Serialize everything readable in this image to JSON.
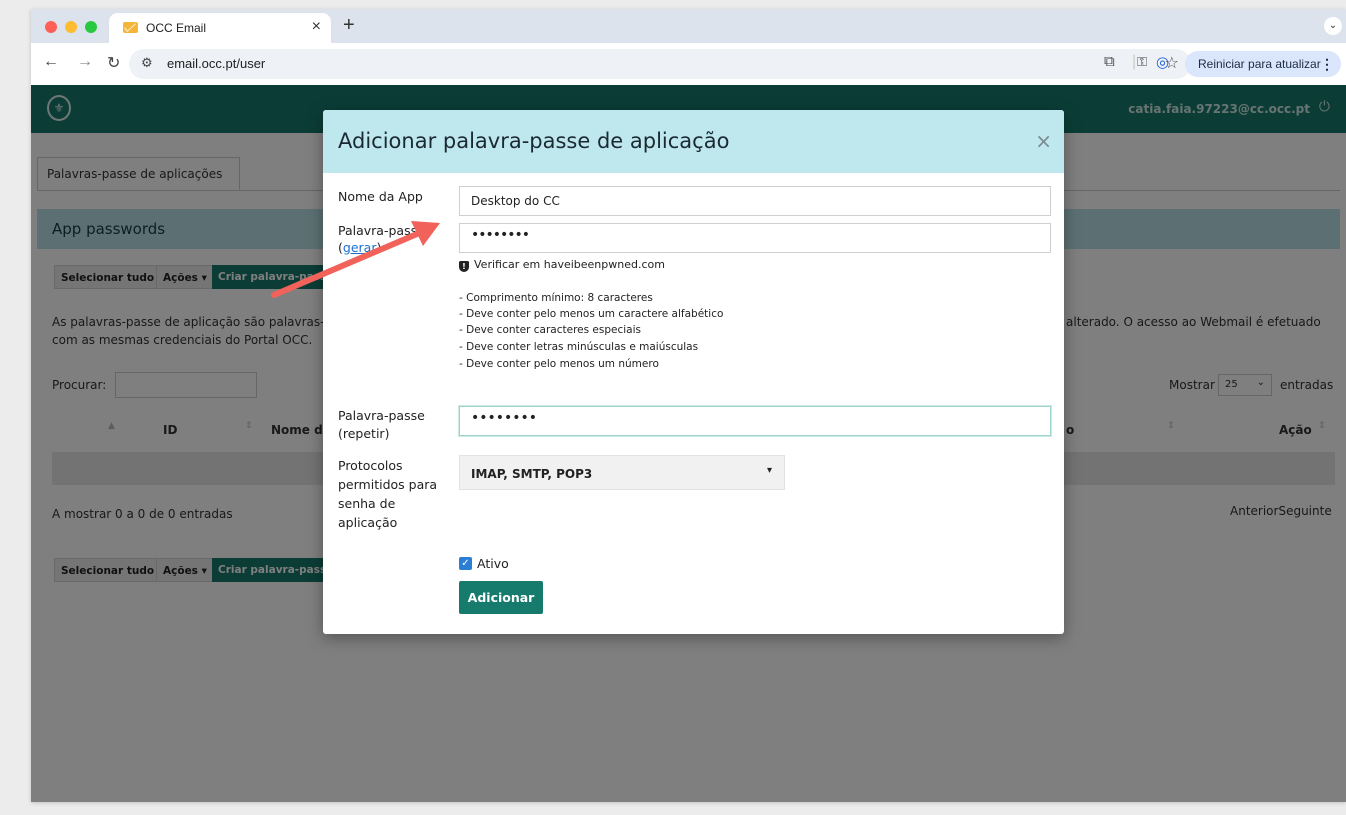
{
  "browser": {
    "tab_title": "OCC Email",
    "tab_close": "×",
    "new_tab": "+",
    "url": "email.occ.pt/user",
    "update_button": "Reiniciar para atualizar",
    "menu_dots": "⋮"
  },
  "app": {
    "user_email": "catia.faia.97223@cc.occ.pt",
    "tab_label": "Palavras-passe de aplicações",
    "panel_title": "App passwords",
    "toolbar": {
      "select_all": "Selecionar tudo",
      "actions": "Ações ▾",
      "create": "Criar palavra-passe"
    },
    "description_left_line1": "As palavras-passe de aplicação são palavras-",
    "description_left_line2": "com as mesmas credenciais do Portal OCC.",
    "description_right": "alterado. O acesso ao Webmail é efetuado",
    "search_label": "Procurar:",
    "show_label": "Mostrar",
    "show_value": "25",
    "entries_label": "entradas",
    "columns": {
      "id": "ID",
      "name": "Nome d",
      "right": "o",
      "action": "Ação"
    },
    "showing": "A mostrar 0 a 0 de 0 entradas",
    "pagination": "AnteriorSeguinte"
  },
  "modal": {
    "title": "Adicionar palavra-passe de aplicação",
    "close": "×",
    "app_name_label": "Nome da App",
    "app_name_value": "Desktop do CC",
    "password_label": "Palavra-passe",
    "generate_link": "gerar",
    "password_value": "••••••••",
    "verify_text": "Verificar em haveibeenpwned.com",
    "requirements": [
      "- Comprimento mínimo: 8 caracteres",
      "- Deve conter pelo menos um caractere alfabético",
      "- Deve conter caracteres especiais",
      "- Deve conter letras minúsculas e maiúsculas",
      "- Deve conter pelo menos um número"
    ],
    "repeat_label_line1": "Palavra-passe",
    "repeat_label_line2": "(repetir)",
    "repeat_value": "••••••••",
    "protocols_label": [
      "Protocolos",
      "permitidos para",
      "senha de",
      "aplicação"
    ],
    "protocols_value": "IMAP, SMTP, POP3",
    "active_label": "Ativo",
    "active_checked": true,
    "add_button": "Adicionar"
  },
  "annotation": {
    "arrow_color": "#f0625a"
  },
  "colors": {
    "brand": "#167a6c",
    "panel_header": "#b9e0e6",
    "modal_header": "#bfe8ee"
  }
}
